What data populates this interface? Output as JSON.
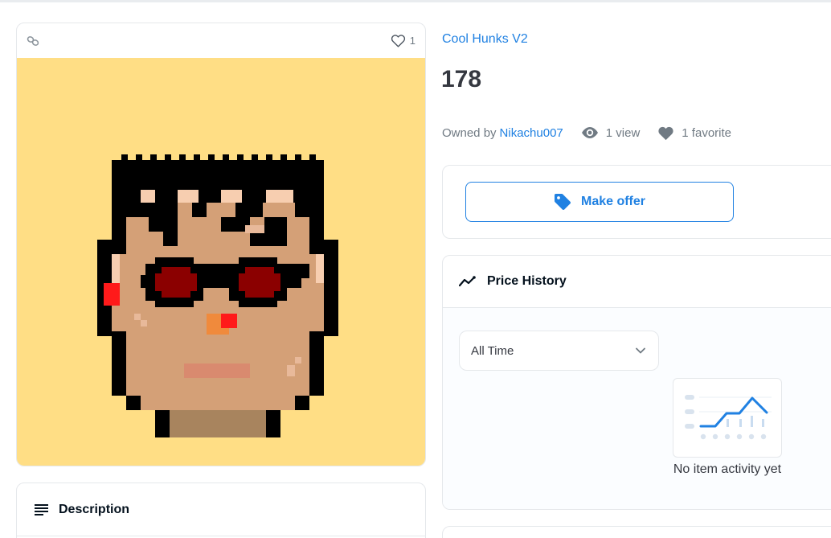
{
  "item": {
    "collection": "Cool Hunks V2",
    "title": "178",
    "owned_by_label": "Owned by",
    "owner": "Nikachu007",
    "views": "1 view",
    "favorites": "1 favorite",
    "favorite_count": "1"
  },
  "offer": {
    "button_label": "Make offer"
  },
  "description": {
    "title": "Description"
  },
  "price_history": {
    "title": "Price History",
    "range_selected": "All Time",
    "empty_text": "No item activity yet"
  },
  "colors": {
    "accent": "#2081e2",
    "image_background": "#ffde85",
    "skin": "#d4a077",
    "hair": "#000000",
    "glasses_lens": "#8b0000",
    "earring": "#ff1a1a"
  },
  "icons": {
    "chain": "chain-link-icon",
    "favorite": "heart-outline-icon",
    "views": "eye-icon",
    "favorites": "heart-filled-icon",
    "offer": "tag-icon",
    "price_history": "trend-line-icon",
    "range": "chevron-down-icon",
    "description": "list-lines-icon"
  }
}
